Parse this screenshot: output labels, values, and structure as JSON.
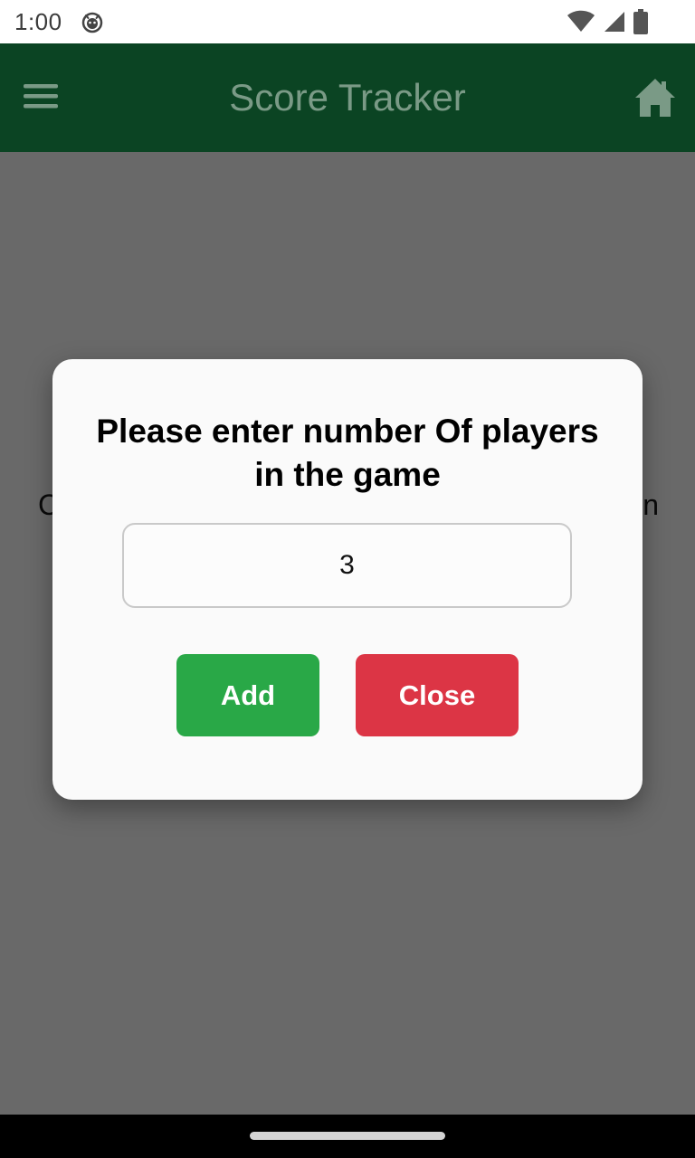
{
  "status_bar": {
    "time": "1:00",
    "app_icon": "android-debug-icon",
    "wifi_icon": "wifi-icon",
    "signal_icon": "cell-signal-icon",
    "battery_icon": "battery-icon"
  },
  "app_bar": {
    "title": "Score Tracker",
    "menu_icon": "hamburger-menu-icon",
    "home_icon": "home-icon",
    "background_color": "#0b4423"
  },
  "background": {
    "text_left": "C",
    "text_right": "n"
  },
  "dialog": {
    "title": "Please enter number Of players in the game",
    "input_value": "3",
    "add_label": "Add",
    "close_label": "Close",
    "add_color": "#29a847",
    "close_color": "#dc3545"
  }
}
